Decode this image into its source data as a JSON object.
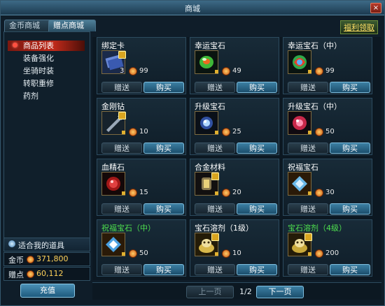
{
  "window": {
    "title": "商城",
    "close_label": "×"
  },
  "tabs": [
    {
      "label": "金币商城"
    },
    {
      "label": "赠点商城"
    }
  ],
  "welfare_link": "福利领取",
  "sidebar": {
    "items": [
      {
        "label": "商品列表",
        "selected": true
      },
      {
        "label": "装备强化"
      },
      {
        "label": "坐骑时装"
      },
      {
        "label": "转职重修"
      },
      {
        "label": "药剂"
      }
    ]
  },
  "suitable_label": "适合我的道具",
  "currency": {
    "gold_label": "金币",
    "gold_value": "371,800",
    "points_label": "赠点",
    "points_value": "60,112"
  },
  "recharge_label": "充值",
  "actions": {
    "gift": "赠送",
    "buy": "购买"
  },
  "items": [
    {
      "name": "绑定卡",
      "name_color": "#ffffff",
      "qty": "3",
      "price": "99",
      "icon": "card-icon"
    },
    {
      "name": "幸运宝石",
      "name_color": "#ffffff",
      "qty": "",
      "price": "49",
      "icon": "green-gem-icon"
    },
    {
      "name": "幸运宝石（中）",
      "name_color": "#ffffff",
      "qty": "",
      "price": "99",
      "icon": "rainbow-gem-icon"
    },
    {
      "name": "金刚钻",
      "name_color": "#ffffff",
      "qty": "",
      "price": "10",
      "icon": "diamond-drill-icon"
    },
    {
      "name": "升级宝石",
      "name_color": "#ffffff",
      "qty": "",
      "price": "25",
      "icon": "blue-gem-icon"
    },
    {
      "name": "升级宝石（中）",
      "name_color": "#ffffff",
      "qty": "",
      "price": "50",
      "icon": "red-gem-icon"
    },
    {
      "name": "血精石",
      "name_color": "#ffffff",
      "qty": "",
      "price": "15",
      "icon": "blood-stone-icon"
    },
    {
      "name": "合金材料",
      "name_color": "#ffffff",
      "qty": "",
      "price": "20",
      "icon": "alloy-icon"
    },
    {
      "name": "祝福宝石",
      "name_color": "#ffffff",
      "qty": "",
      "price": "30",
      "icon": "blessing-gem-icon"
    },
    {
      "name": "祝福宝石（中）",
      "name_color": "#4ee04e",
      "qty": "",
      "price": "50",
      "icon": "blessing-gem-mid-icon"
    },
    {
      "name": "宝石溶剂（1级）",
      "name_color": "#ffffff",
      "qty": "",
      "price": "10",
      "icon": "solvent-1-icon"
    },
    {
      "name": "宝石溶剂（4级）",
      "name_color": "#4ee04e",
      "qty": "",
      "price": "200",
      "icon": "solvent-4-icon"
    }
  ],
  "pagination": {
    "prev_label": "上一页",
    "page": "1/2",
    "next_label": "下一页"
  }
}
